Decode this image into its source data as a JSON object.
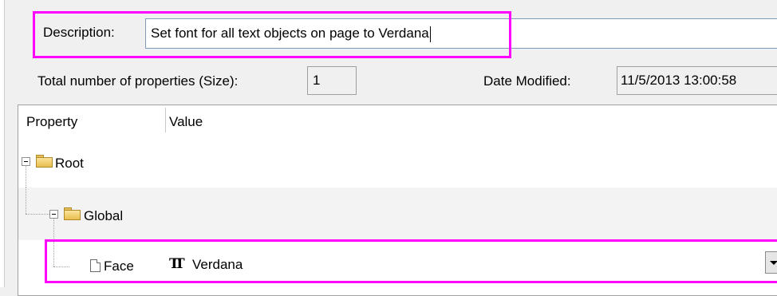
{
  "description": {
    "label": "Description:",
    "value": "Set font for all text objects on page to Verdana"
  },
  "size": {
    "label": "Total number of properties (Size):",
    "value": "1"
  },
  "date_modified": {
    "label": "Date Modified:",
    "value": "11/5/2013 13:00:58"
  },
  "grid": {
    "columns": [
      "Property",
      "Value"
    ],
    "rows": [
      {
        "label": "Root",
        "icon": "folder-icon"
      },
      {
        "label": "Global",
        "icon": "folder-icon"
      },
      {
        "label": "Face",
        "icon": "document-icon",
        "value_icon": "truetype-font-icon",
        "value": "Verdana"
      }
    ]
  },
  "colors": {
    "highlight": "#ff00ff",
    "background": "#f0f0f0"
  }
}
